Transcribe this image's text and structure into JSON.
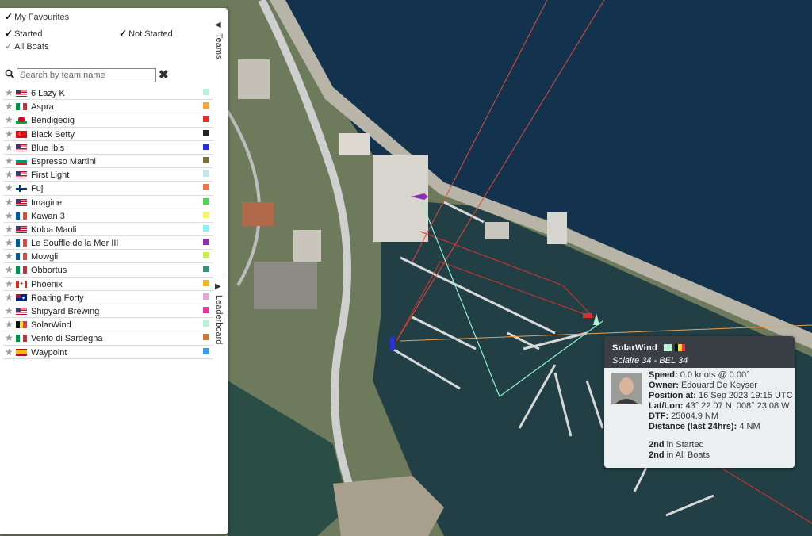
{
  "filters": {
    "favourites": "My Favourites",
    "started": "Started",
    "not_started": "Not Started",
    "all_boats": "All Boats"
  },
  "search": {
    "placeholder": "Search by team name"
  },
  "tabs": {
    "teams": "Teams",
    "leaderboard": "Leaderboard"
  },
  "teams": [
    {
      "name": "6 Lazy K",
      "flag": "us",
      "color": "#b5f5d9"
    },
    {
      "name": "Aspra",
      "flag": "it",
      "color": "#f2a53a"
    },
    {
      "name": "Bendigedig",
      "flag": "wales",
      "color": "#d9342b"
    },
    {
      "name": "Black Betty",
      "flag": "tr",
      "color": "#222222"
    },
    {
      "name": "Blue Ibis",
      "flag": "us",
      "color": "#2a2ee0"
    },
    {
      "name": "Espresso Martini",
      "flag": "bg",
      "color": "#7a6e3a"
    },
    {
      "name": "First Light",
      "flag": "us",
      "color": "#bfe6ee"
    },
    {
      "name": "Fuji",
      "flag": "fi",
      "color": "#e8764e"
    },
    {
      "name": "Imagine",
      "flag": "us",
      "color": "#4ed84e"
    },
    {
      "name": "Kawan 3",
      "flag": "fr",
      "color": "#f5f56a"
    },
    {
      "name": "Koloa Maoli",
      "flag": "us",
      "color": "#8ff0f0"
    },
    {
      "name": "Le Souffle de la Mer III",
      "flag": "fr",
      "color": "#8b2fb0"
    },
    {
      "name": "Mowgli",
      "flag": "fr",
      "color": "#c9ec55"
    },
    {
      "name": "Obbortus",
      "flag": "it",
      "color": "#3a8f7a"
    },
    {
      "name": "Phoenix",
      "flag": "ca",
      "color": "#f2b52a"
    },
    {
      "name": "Roaring Forty",
      "flag": "au",
      "color": "#e4a6d8"
    },
    {
      "name": "Shipyard Brewing",
      "flag": "us",
      "color": "#e23a9a"
    },
    {
      "name": "SolarWind",
      "flag": "be",
      "color": "#b6f2d3"
    },
    {
      "name": "Vento di Sardegna",
      "flag": "it",
      "color": "#c8783a"
    },
    {
      "name": "Waypoint",
      "flag": "es",
      "color": "#3a9ae8"
    }
  ],
  "popup": {
    "name": "SolarWind",
    "subtitle": "Solaire 34 - BEL 34",
    "speed_label": "Speed:",
    "speed": "0.0 knots @ 0.00°",
    "owner_label": "Owner:",
    "owner": "Edouard De Keyser",
    "position_label": "Position at:",
    "position": "16 Sep 2023 19:15 UTC",
    "latlon_label": "Lat/Lon:",
    "latlon": "43° 22.07 N, 008° 23.08 W",
    "dtf_label": "DTF:",
    "dtf": "25004.9 NM",
    "distance_label": "Distance (last 24hrs):",
    "distance": "4 NM",
    "rank1_pos": "2nd",
    "rank1_text": "in Started",
    "rank2_pos": "2nd",
    "rank2_text": "in All Boats",
    "swatch_color": "#b6f2d3",
    "flag": "be"
  }
}
